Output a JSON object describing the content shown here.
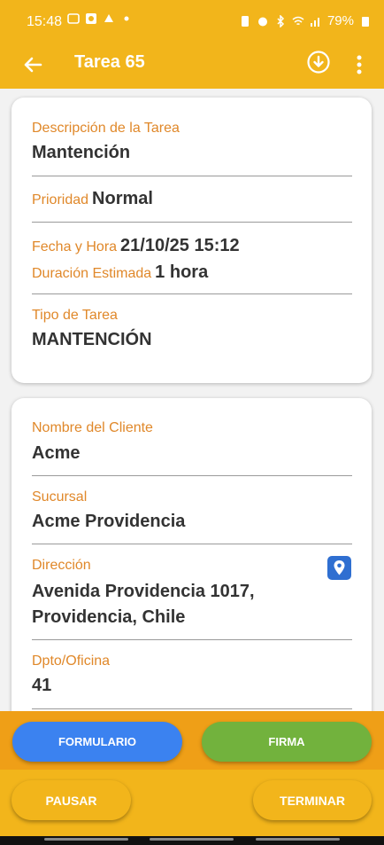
{
  "status_bar": {
    "time": "15:48",
    "battery": "79%"
  },
  "app_bar": {
    "title": "Tarea 65"
  },
  "task": {
    "description_label": "Descripción de la Tarea",
    "description_value": "Mantención",
    "priority_label": "Prioridad",
    "priority_value": "Normal",
    "datetime_label": "Fecha y Hora",
    "datetime_value": "21/10/25 15:12",
    "duration_label": "Duración Estimada",
    "duration_value": "1 hora",
    "type_label": "Tipo de Tarea",
    "type_value": "MANTENCIÓN"
  },
  "client": {
    "name_label": "Nombre del Cliente",
    "name_value": "Acme",
    "branch_label": "Sucursal",
    "branch_value": "Acme Providencia",
    "address_label": "Dirección",
    "address_line1": "Avenida Providencia 1017,",
    "address_line2": "Providencia, Chile",
    "office_label": "Dpto/Oficina",
    "office_value": "41"
  },
  "actions": {
    "form_label": "FORMULARIO",
    "sign_label": "FIRMA",
    "pause_label": "PAUSAR",
    "finish_label": "TERMINAR"
  },
  "colors": {
    "primary": "#f2b51b",
    "accent_orange": "#ef9f17",
    "label_orange": "#e0882a",
    "form_blue": "#3b82f0",
    "sign_green": "#72b23d",
    "location_blue": "#2f6fd1"
  },
  "icons": [
    "back-arrow-icon",
    "download-icon",
    "more-vert-icon",
    "location-pin-icon"
  ]
}
